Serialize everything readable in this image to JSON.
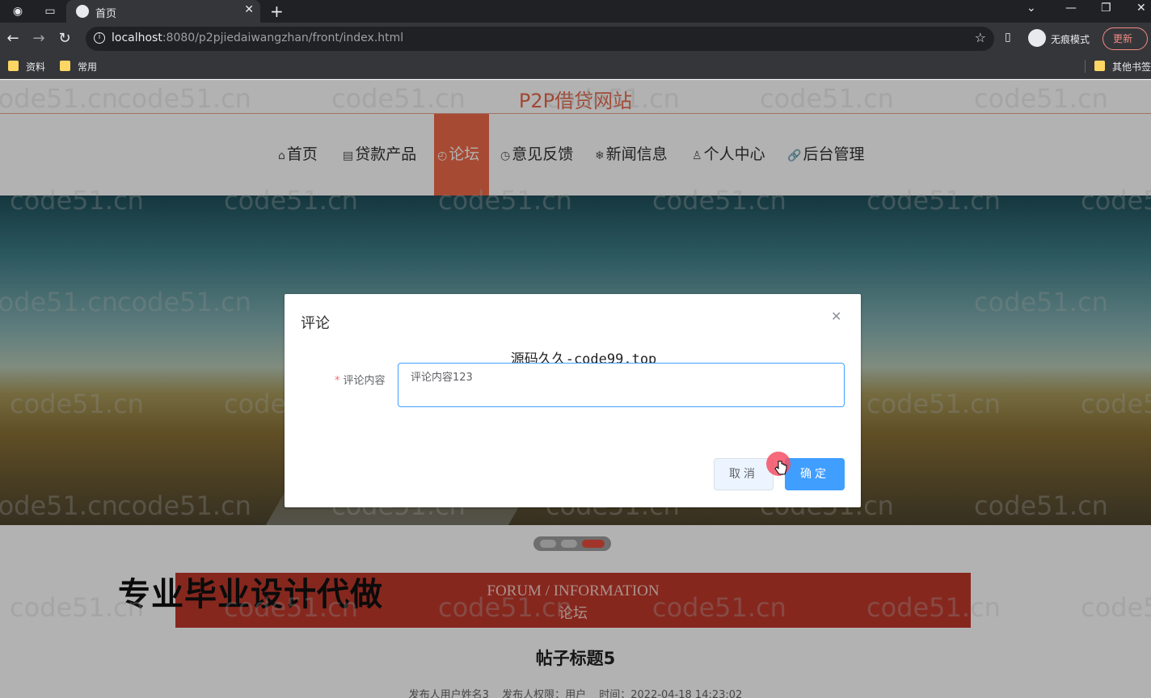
{
  "browser": {
    "tab_title": "首页",
    "url_host": "localhost",
    "url_rest": ":8080/p2pjiedaiwangzhan/front/index.html",
    "incognito_label": "无痕模式",
    "update_label": "更新",
    "bookmarks": [
      "资料",
      "常用"
    ],
    "other_bookmarks": "其他书签"
  },
  "site": {
    "title": "P2P借贷网站",
    "nav": [
      {
        "label": "首页",
        "icon": "home-icon"
      },
      {
        "label": "贷款产品",
        "icon": "product-icon"
      },
      {
        "label": "论坛",
        "icon": "forum-icon",
        "active": true
      },
      {
        "label": "意见反馈",
        "icon": "clock-icon"
      },
      {
        "label": "新闻信息",
        "icon": "snowflake-icon"
      },
      {
        "label": "个人中心",
        "icon": "user-icon"
      },
      {
        "label": "后台管理",
        "icon": "link-icon"
      }
    ]
  },
  "section": {
    "en": "FORUM / INFORMATION",
    "cn": "论坛"
  },
  "promo_text": "专业毕业设计代做",
  "post": {
    "title": "帖子标题5",
    "author": "发布人用户姓名3",
    "role": "发布人权限：用户",
    "time": "时间：2022-04-18 14:23:02"
  },
  "dialog": {
    "title": "评论",
    "stamp": "源码久久-code99.top",
    "label": "评论内容",
    "required_mark": "*",
    "textarea_value": "评论内容123",
    "cancel": "取消",
    "confirm": "确定"
  },
  "watermark": "code51.cn"
}
